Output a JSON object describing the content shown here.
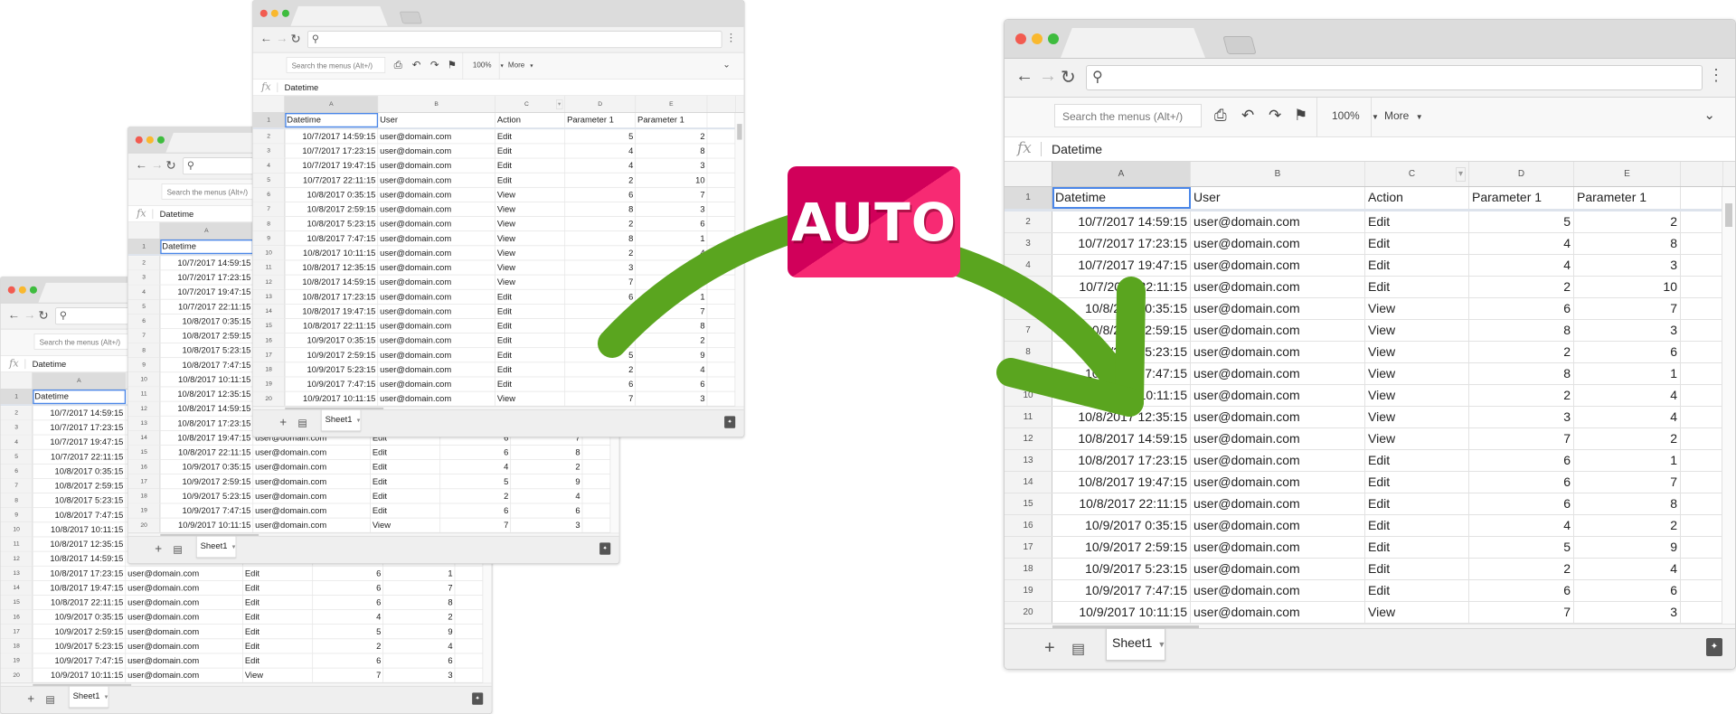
{
  "browser": {
    "traffic_lights": {
      "close": "#f25b50",
      "minimize": "#f9b82e",
      "maximize": "#3ebc3e"
    },
    "icons": [
      "back-arrow-icon",
      "forward-arrow-icon",
      "reload-icon",
      "search-icon",
      "more-vert-icon"
    ]
  },
  "toolbar": {
    "search_placeholder": "Search the menus (Alt+/)",
    "zoom": "100%",
    "more": "More"
  },
  "formula_bar": {
    "fx": "fx",
    "value": "Datetime"
  },
  "columns": [
    "A",
    "B",
    "C",
    "D",
    "E"
  ],
  "header_row": [
    "Datetime",
    "User",
    "Action",
    "Parameter 1",
    "Parameter 1"
  ],
  "rows": [
    [
      "10/7/2017 14:59:15",
      "user@domain.com",
      "Edit",
      "5",
      "2"
    ],
    [
      "10/7/2017 17:23:15",
      "user@domain.com",
      "Edit",
      "4",
      "8"
    ],
    [
      "10/7/2017 19:47:15",
      "user@domain.com",
      "Edit",
      "4",
      "3"
    ],
    [
      "10/7/2017 22:11:15",
      "user@domain.com",
      "Edit",
      "2",
      "10"
    ],
    [
      "10/8/2017 0:35:15",
      "user@domain.com",
      "View",
      "6",
      "7"
    ],
    [
      "10/8/2017 2:59:15",
      "user@domain.com",
      "View",
      "8",
      "3"
    ],
    [
      "10/8/2017 5:23:15",
      "user@domain.com",
      "View",
      "2",
      "6"
    ],
    [
      "10/8/2017 7:47:15",
      "user@domain.com",
      "View",
      "8",
      "1"
    ],
    [
      "10/8/2017 10:11:15",
      "user@domain.com",
      "View",
      "2",
      "4"
    ],
    [
      "10/8/2017 12:35:15",
      "user@domain.com",
      "View",
      "3",
      "4"
    ],
    [
      "10/8/2017 14:59:15",
      "user@domain.com",
      "View",
      "7",
      "2"
    ],
    [
      "10/8/2017 17:23:15",
      "user@domain.com",
      "Edit",
      "6",
      "1"
    ],
    [
      "10/8/2017 19:47:15",
      "user@domain.com",
      "Edit",
      "6",
      "7"
    ],
    [
      "10/8/2017 22:11:15",
      "user@domain.com",
      "Edit",
      "6",
      "8"
    ],
    [
      "10/9/2017 0:35:15",
      "user@domain.com",
      "Edit",
      "4",
      "2"
    ],
    [
      "10/9/2017 2:59:15",
      "user@domain.com",
      "Edit",
      "5",
      "9"
    ],
    [
      "10/9/2017 5:23:15",
      "user@domain.com",
      "Edit",
      "2",
      "4"
    ],
    [
      "10/9/2017 7:47:15",
      "user@domain.com",
      "Edit",
      "6",
      "6"
    ],
    [
      "10/9/2017 10:11:15",
      "user@domain.com",
      "View",
      "7",
      "3"
    ]
  ],
  "sheet_tab": "Sheet1",
  "badge": {
    "label": "AUTO",
    "color_dark": "#d1005a",
    "color_light": "#f72a73"
  },
  "arrow_color": "#5aa51f"
}
